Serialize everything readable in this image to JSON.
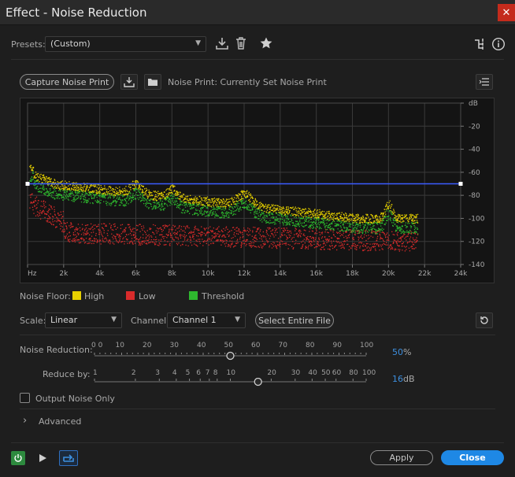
{
  "window": {
    "title": "Effect - Noise Reduction",
    "close_glyph": "✕"
  },
  "presets": {
    "label": "Presets:",
    "value": "(Custom)"
  },
  "noise_print": {
    "capture_label": "Capture Noise Print",
    "status": "Noise Print: Currently Set Noise Print"
  },
  "graph": {
    "db_labels": [
      "dB",
      "-20",
      "-40",
      "-60",
      "-80",
      "-100",
      "-120",
      "-140"
    ],
    "freq_labels": [
      "Hz",
      "2k",
      "4k",
      "6k",
      "8k",
      "10k",
      "12k",
      "14k",
      "16k",
      "18k",
      "20k",
      "22k",
      "24k"
    ],
    "threshold_db": -70
  },
  "legend": {
    "label": "Noise Floor:",
    "high": "High",
    "low": "Low",
    "threshold": "Threshold",
    "colors": {
      "high": "#e6d000",
      "low": "#d92b2b",
      "threshold": "#2eb82e",
      "line": "#3a5cff"
    }
  },
  "scale": {
    "label": "Scale:",
    "value": "Linear"
  },
  "channel": {
    "label": "Channel:",
    "value": "Channel 1"
  },
  "select_file_label": "Select Entire File",
  "noise_reduction": {
    "label": "Noise Reduction:",
    "ticks": [
      "0 0",
      "10",
      "20",
      "30",
      "40",
      "50",
      "60",
      "70",
      "80",
      "90",
      "100"
    ],
    "value": "50",
    "unit": "%"
  },
  "reduce_by": {
    "label": "Reduce by:",
    "ticks": [
      "1",
      "2",
      "3",
      "4",
      "5",
      "6",
      "7",
      "8",
      "10",
      "20",
      "30",
      "40",
      "50",
      "60",
      "80",
      "100"
    ],
    "value": "16",
    "unit": "dB"
  },
  "output_noise_only": "Output Noise Only",
  "advanced": {
    "label": "Advanced",
    "chevron": "›"
  },
  "footer": {
    "apply": "Apply",
    "close": "Close"
  }
}
